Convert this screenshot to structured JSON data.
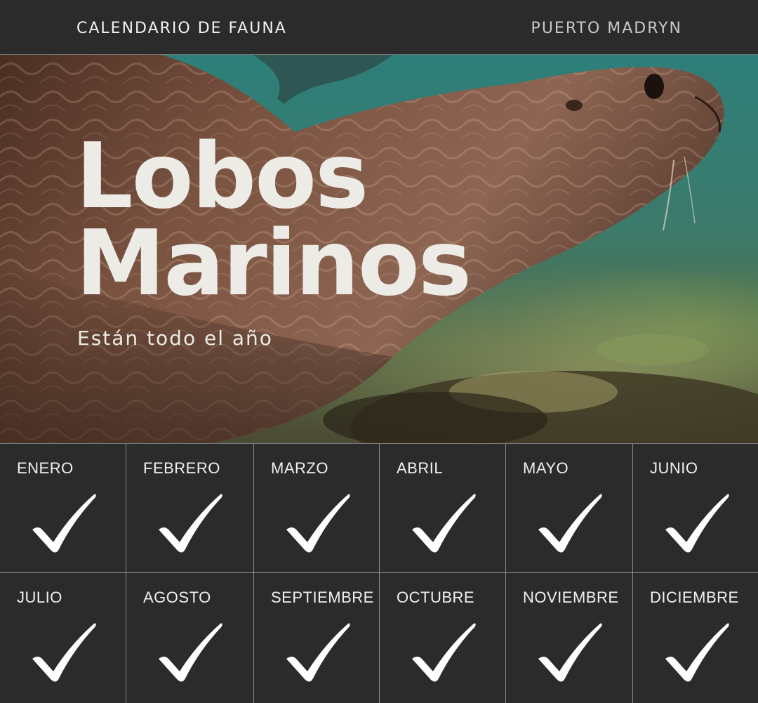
{
  "header": {
    "left_label": "CALENDARIO DE FAUNA",
    "right_label": "PUERTO MADRYN"
  },
  "hero": {
    "title_line1": "Lobos",
    "title_line2": "Marinos",
    "subtitle": "Están todo el año"
  },
  "calendar": {
    "months": [
      {
        "label": "ENERO",
        "present": true
      },
      {
        "label": "FEBRERO",
        "present": true
      },
      {
        "label": "MARZO",
        "present": true
      },
      {
        "label": "ABRIL",
        "present": true
      },
      {
        "label": "MAYO",
        "present": true
      },
      {
        "label": "JUNIO",
        "present": true
      },
      {
        "label": "JULIO",
        "present": true
      },
      {
        "label": "AGOSTO",
        "present": true
      },
      {
        "label": "SEPTIEMBRE",
        "present": true
      },
      {
        "label": "OCTUBRE",
        "present": true
      },
      {
        "label": "NOVIEMBRE",
        "present": true
      },
      {
        "label": "DICIEMBRE",
        "present": true
      }
    ],
    "check_icon": "checkmark-icon"
  },
  "colors": {
    "background": "#2b2b2b",
    "text": "#ecebe6",
    "divider": "#8a8a8a"
  }
}
